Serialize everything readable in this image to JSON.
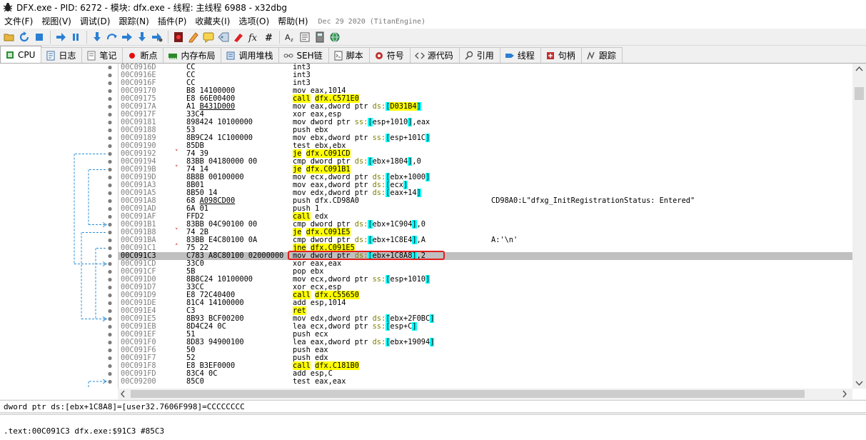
{
  "window": {
    "title": "DFX.exe - PID: 6272 - 模块: dfx.exe - 线程: 主线程 6988 - x32dbg"
  },
  "menu": {
    "items": [
      "文件(F)",
      "视图(V)",
      "调试(D)",
      "跟踪(N)",
      "插件(P)",
      "收藏夹(I)",
      "选项(O)",
      "帮助(H)"
    ],
    "build_date": "Dec 29 2020 (TitanEngine)"
  },
  "toolbar": {
    "icons": [
      "open-icon",
      "restart-icon",
      "stop-icon",
      "run-icon",
      "pause-icon",
      "step-into-icon",
      "step-over-icon",
      "run-to-user-icon",
      "execute-till-return-icon",
      "run-to-cursor-icon",
      "breakpoint-icon",
      "patch-icon",
      "comment-icon",
      "label-icon",
      "bookmark-icon",
      "function-icon",
      "hash-icon",
      "font-icon",
      "strings-icon",
      "calculator-icon",
      "globe-icon"
    ]
  },
  "tabs": [
    {
      "label": "CPU",
      "icon": "cpu-icon",
      "color": "#2a7fd4"
    },
    {
      "label": "日志",
      "icon": "log-icon",
      "color": "#3a6ea5"
    },
    {
      "label": "笔记",
      "icon": "notes-icon",
      "color": "#7a7a7a"
    },
    {
      "label": "断点",
      "icon": "breakpoint-dot-icon",
      "color": "#e01010"
    },
    {
      "label": "内存布局",
      "icon": "memory-icon",
      "color": "#2a8a2a"
    },
    {
      "label": "调用堆栈",
      "icon": "callstack-icon",
      "color": "#3a6ea5"
    },
    {
      "label": "SEH链",
      "icon": "seh-icon",
      "color": "#555555"
    },
    {
      "label": "脚本",
      "icon": "script-icon",
      "color": "#555555"
    },
    {
      "label": "符号",
      "icon": "symbol-icon",
      "color": "#c03030"
    },
    {
      "label": "源代码",
      "icon": "source-icon",
      "color": "#555555"
    },
    {
      "label": "引用",
      "icon": "search-icon",
      "color": "#555555"
    },
    {
      "label": "线程",
      "icon": "thread-icon",
      "color": "#2a7fd4"
    },
    {
      "label": "句柄",
      "icon": "handle-icon",
      "color": "#c03030"
    },
    {
      "label": "跟踪",
      "icon": "trace-icon",
      "color": "#555555"
    }
  ],
  "disasm": {
    "rows": [
      {
        "addr": "00C0916D",
        "bytes": "CC",
        "asm": "int3"
      },
      {
        "addr": "00C0916E",
        "bytes": "CC",
        "asm": "int3"
      },
      {
        "addr": "00C0916F",
        "bytes": "CC",
        "asm": "int3"
      },
      {
        "addr": "00C09170",
        "bytes": "B8 14100000",
        "asm": "mov eax,1014"
      },
      {
        "addr": "00C09175",
        "bytes": "E8 66E00400",
        "asm": "call dfx.C571E0"
      },
      {
        "addr": "00C0917A",
        "bytes": "A1 B431D000",
        "asm": "mov eax,dword ptr ds:[D031B4]"
      },
      {
        "addr": "00C0917F",
        "bytes": "33C4",
        "asm": "xor eax,esp"
      },
      {
        "addr": "00C09181",
        "bytes": "898424 10100000",
        "asm": "mov dword ptr ss:[esp+1010],eax"
      },
      {
        "addr": "00C09188",
        "bytes": "53",
        "asm": "push ebx"
      },
      {
        "addr": "00C09189",
        "bytes": "8B9C24 1C100000",
        "asm": "mov ebx,dword ptr ss:[esp+101C]"
      },
      {
        "addr": "00C09190",
        "bytes": "85DB",
        "asm": "test ebx,ebx"
      },
      {
        "addr": "00C09192",
        "bytes": "74 39",
        "asm": "je dfx.C091CD"
      },
      {
        "addr": "00C09194",
        "bytes": "83BB 04180000 00",
        "asm": "cmp dword ptr ds:[ebx+1804],0"
      },
      {
        "addr": "00C0919B",
        "bytes": "74 14",
        "asm": "je dfx.C091B1"
      },
      {
        "addr": "00C0919D",
        "bytes": "8B8B 00100000",
        "asm": "mov ecx,dword ptr ds:[ebx+1000]"
      },
      {
        "addr": "00C091A3",
        "bytes": "8B01",
        "asm": "mov eax,dword ptr ds:[ecx]"
      },
      {
        "addr": "00C091A5",
        "bytes": "8B50 14",
        "asm": "mov edx,dword ptr ds:[eax+14]"
      },
      {
        "addr": "00C091A8",
        "bytes": "68 A098CD00",
        "asm": "push dfx.CD98A0",
        "comment": "CD98A0:L\"dfxg_InitRegistrationStatus: Entered\""
      },
      {
        "addr": "00C091AD",
        "bytes": "6A 01",
        "asm": "push 1"
      },
      {
        "addr": "00C091AF",
        "bytes": "FFD2",
        "asm": "call edx"
      },
      {
        "addr": "00C091B1",
        "bytes": "83BB 04C90100 00",
        "asm": "cmp dword ptr ds:[ebx+1C904],0"
      },
      {
        "addr": "00C091B8",
        "bytes": "74 2B",
        "asm": "je dfx.C091E5"
      },
      {
        "addr": "00C091BA",
        "bytes": "83BB E4C80100 0A",
        "asm": "cmp dword ptr ds:[ebx+1C8E4],A",
        "comment": "A:'\\n'"
      },
      {
        "addr": "00C091C1",
        "bytes": "75 22",
        "asm": "jne dfx.C091E5"
      },
      {
        "addr": "00C091C3",
        "bytes": "C783 A8C80100 02000000",
        "asm": "mov dword ptr ds:[ebx+1C8A8],2"
      },
      {
        "addr": "00C091CD",
        "bytes": "33C0",
        "asm": "xor eax,eax"
      },
      {
        "addr": "00C091CF",
        "bytes": "5B",
        "asm": "pop ebx"
      },
      {
        "addr": "00C091D0",
        "bytes": "8B8C24 10100000",
        "asm": "mov ecx,dword ptr ss:[esp+1010]"
      },
      {
        "addr": "00C091D7",
        "bytes": "33CC",
        "asm": "xor ecx,esp"
      },
      {
        "addr": "00C091D9",
        "bytes": "E8 72C40400",
        "asm": "call dfx.C55650"
      },
      {
        "addr": "00C091DE",
        "bytes": "81C4 14100000",
        "asm": "add esp,1014"
      },
      {
        "addr": "00C091E4",
        "bytes": "C3",
        "asm": "ret"
      },
      {
        "addr": "00C091E5",
        "bytes": "8B93 BCF00200",
        "asm": "mov edx,dword ptr ds:[ebx+2F0BC]"
      },
      {
        "addr": "00C091EB",
        "bytes": "8D4C24 0C",
        "asm": "lea ecx,dword ptr ss:[esp+C]"
      },
      {
        "addr": "00C091EF",
        "bytes": "51",
        "asm": "push ecx"
      },
      {
        "addr": "00C091F0",
        "bytes": "8D83 94900100",
        "asm": "lea eax,dword ptr ds:[ebx+19094]"
      },
      {
        "addr": "00C091F6",
        "bytes": "50",
        "asm": "push eax"
      },
      {
        "addr": "00C091F7",
        "bytes": "52",
        "asm": "push edx"
      },
      {
        "addr": "00C091F8",
        "bytes": "E8 B3EF0000",
        "asm": "call dfx.C181B0"
      },
      {
        "addr": "00C091FD",
        "bytes": "83C4 0C",
        "asm": "add esp,C"
      },
      {
        "addr": "00C09200",
        "bytes": "85C0",
        "asm": "test eax,eax"
      }
    ],
    "current_addr": "00C091C3"
  },
  "info": {
    "line1": "dword ptr ds:[ebx+1C8A8]=[user32.7606F998]=CCCCCCCC",
    "line2": ".text:00C091C3 dfx.exe:$91C3 #85C3"
  },
  "colors": {
    "highlight_yellow": "#ffff00",
    "register_cyan": "#00ffff",
    "segment_olive": "#808000",
    "current_row": "#c0c0c0",
    "annotation_red": "#e0201c",
    "jump_line": "#2a8fd8"
  }
}
